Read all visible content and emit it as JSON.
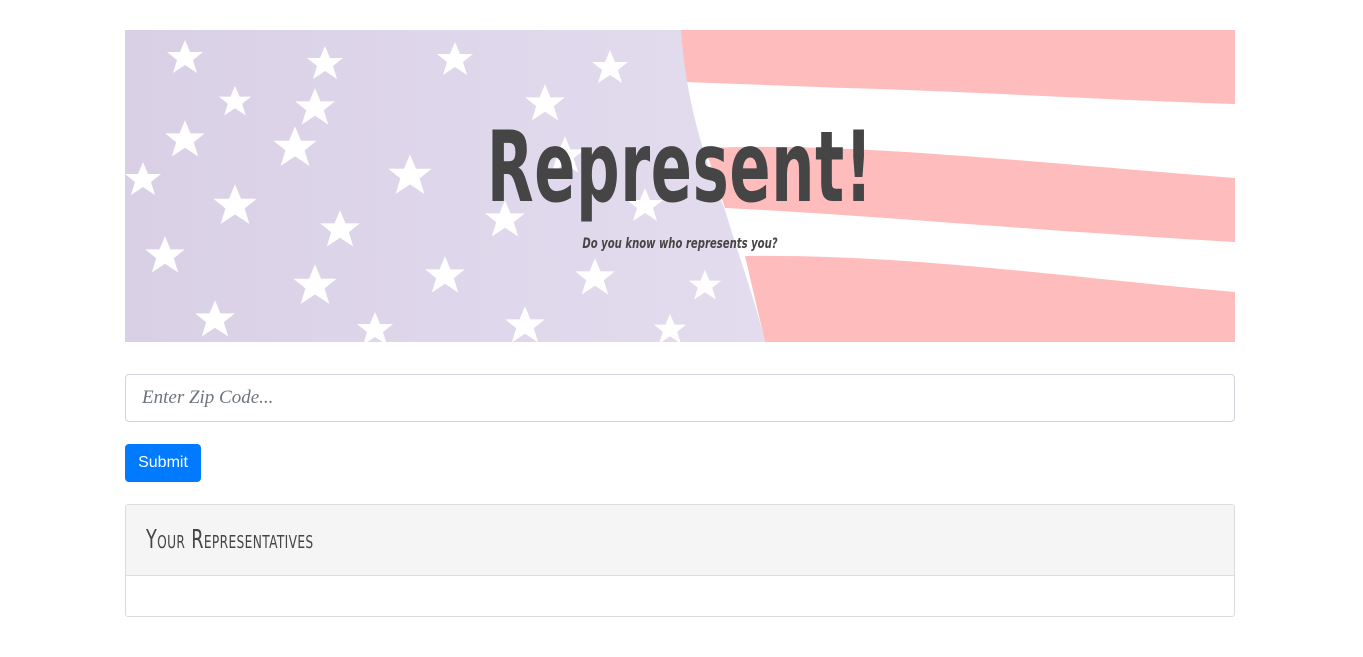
{
  "banner": {
    "title": "Represent!",
    "subtitle": "Do you know who represents you?"
  },
  "form": {
    "zip_placeholder": "Enter Zip Code...",
    "zip_value": "",
    "submit_label": "Submit"
  },
  "results": {
    "header": "Your Representatives",
    "items": []
  },
  "colors": {
    "accent": "#007bff",
    "text": "#454545",
    "flag_red": "#ffbcbc",
    "flag_blue": "#dcd4ea"
  }
}
